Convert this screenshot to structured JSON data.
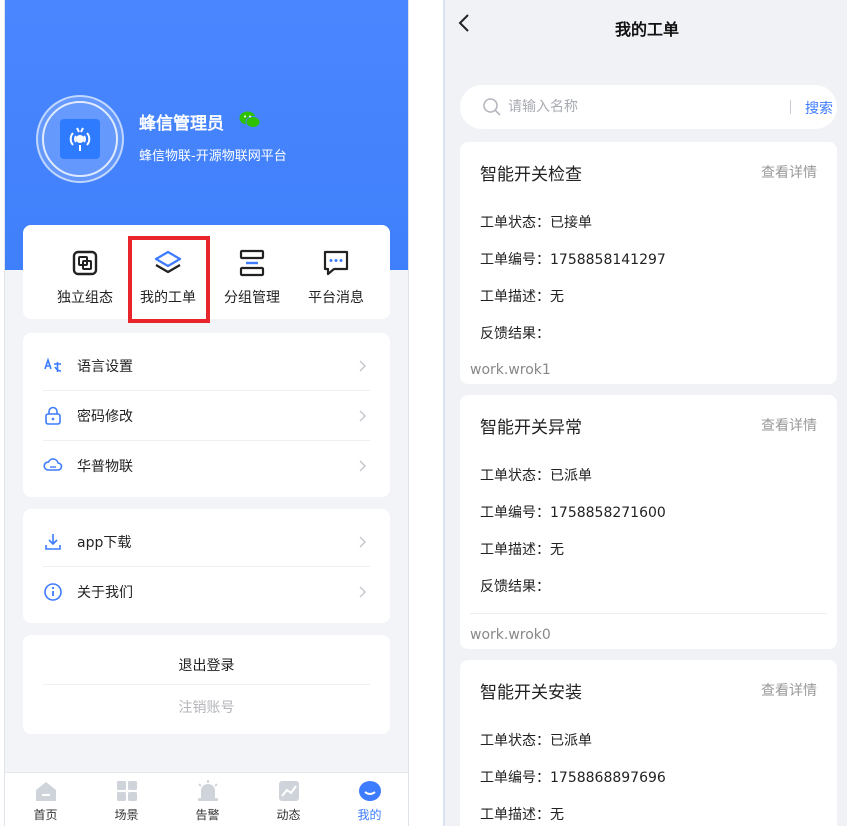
{
  "left": {
    "profile": {
      "name": "蜂信管理员",
      "subtitle": "蜂信物联-开源物联网平台"
    },
    "quick_actions": [
      {
        "label": "独立组态",
        "icon": "layers-box-icon"
      },
      {
        "label": "我的工单",
        "icon": "stack-icon"
      },
      {
        "label": "分组管理",
        "icon": "group-icon"
      },
      {
        "label": "平台消息",
        "icon": "message-icon"
      }
    ],
    "settings_menu": [
      {
        "label": "语言设置",
        "icon": "translate-icon"
      },
      {
        "label": "密码修改",
        "icon": "lock-icon"
      },
      {
        "label": "华普物联",
        "icon": "cloud-icon"
      }
    ],
    "about_menu": [
      {
        "label": "app下载",
        "icon": "download-icon"
      },
      {
        "label": "关于我们",
        "icon": "info-icon"
      }
    ],
    "logout_label": "退出登录",
    "cancel_account_label": "注销账号",
    "tabbar": [
      {
        "label": "首页",
        "icon": "home-icon",
        "active": false
      },
      {
        "label": "场景",
        "icon": "grid-icon",
        "active": false
      },
      {
        "label": "告警",
        "icon": "alarm-icon",
        "active": false
      },
      {
        "label": "动态",
        "icon": "chart-icon",
        "active": false
      },
      {
        "label": "我的",
        "icon": "profile-icon",
        "active": true
      }
    ],
    "colors": {
      "brand": "#3f80fa",
      "highlight": "#e8252b",
      "accent": "#3d7cff"
    }
  },
  "right": {
    "title": "我的工单",
    "search": {
      "placeholder": "请输入名称",
      "button": "搜索"
    },
    "detail_label": "查看详情",
    "orders": [
      {
        "title": "智能开关检查",
        "status": "工单状态：已接单",
        "number": "工单编号：1758858141297",
        "desc": "工单描述：无",
        "feedback": "反馈结果：",
        "footer": "work.wrok1"
      },
      {
        "title": "智能开关异常",
        "status": "工单状态：已派单",
        "number": "工单编号：1758858271600",
        "desc": "工单描述：无",
        "feedback": "反馈结果：",
        "footer": "work.wrok0"
      },
      {
        "title": "智能开关安装",
        "status": "工单状态：已派单",
        "number": "工单编号：1758868897696",
        "desc": "工单描述：无"
      }
    ]
  }
}
